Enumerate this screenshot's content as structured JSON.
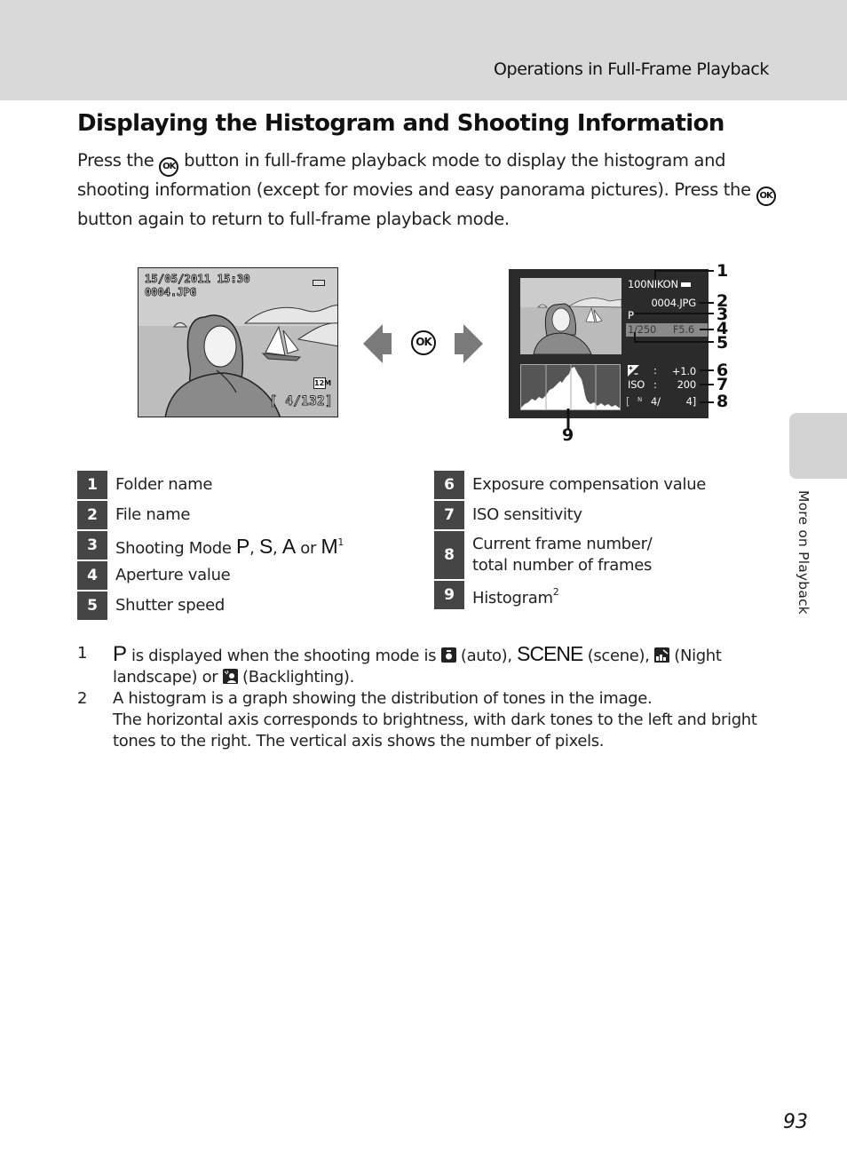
{
  "header": {
    "section_title": "Operations in Full-Frame Playback"
  },
  "page": {
    "title": "Displaying the Histogram and Shooting Information",
    "intro": {
      "part1": "Press the ",
      "ok_label": "OK",
      "part2": " button in full-frame playback mode to display the histogram and shooting information (except for movies and easy panorama pictures). Press the ",
      "part3": " button again to return to full-frame playback mode."
    },
    "page_number": "93",
    "side_tab_label": "More on Playback"
  },
  "figure": {
    "left_screen": {
      "datetime": "15/05/2011  15:30",
      "filename": "0004.JPG",
      "image_size_icon": "12M",
      "counter": "[   4/132]"
    },
    "ok_button_label": "OK",
    "right_screen": {
      "folder": "100NIKON",
      "filename": "0004.JPG",
      "mode": "P",
      "shutter": "1/250",
      "aperture": "F5.6",
      "ev_colon": ":",
      "ev_value": "+1.0",
      "iso_label": "ISO",
      "iso_colon": ":",
      "iso_value": "200",
      "frame_open": "[",
      "frame_mark": "N",
      "frame_current": "4/",
      "frame_total": "4]"
    },
    "callouts": [
      "1",
      "2",
      "3",
      "4",
      "5",
      "6",
      "7",
      "8",
      "9"
    ]
  },
  "legend": {
    "left": [
      {
        "num": "1",
        "label": "Folder name"
      },
      {
        "num": "2",
        "label": "File name"
      },
      {
        "num": "3",
        "label_prefix": "Shooting Mode ",
        "modes": [
          "P",
          "S",
          "A",
          "M"
        ],
        "sep1": ", ",
        "sep2": ", ",
        "sep3": " or ",
        "footnote": "1"
      },
      {
        "num": "4",
        "label": "Aperture value"
      },
      {
        "num": "5",
        "label": "Shutter speed"
      }
    ],
    "right": [
      {
        "num": "6",
        "label": "Exposure compensation value"
      },
      {
        "num": "7",
        "label": "ISO sensitivity"
      },
      {
        "num": "8",
        "label_line1": "Current frame number/",
        "label_line2": "total number of frames"
      },
      {
        "num": "9",
        "label": "Histogram",
        "footnote": "2"
      }
    ]
  },
  "footnotes": [
    {
      "num": "1",
      "p_glyph": "P",
      "t1": " is displayed when the shooting mode is ",
      "t2": " (auto), ",
      "scene": "SCENE",
      "t3": " (scene), ",
      "t4": " (Night landscape) or ",
      "t5": " (Backlighting)."
    },
    {
      "num": "2",
      "line1": "A histogram is a graph showing the distribution of tones in the image.",
      "line2": "The horizontal axis corresponds to brightness, with dark tones to the left and bright tones to the right. The vertical axis shows the number of pixels."
    }
  ]
}
